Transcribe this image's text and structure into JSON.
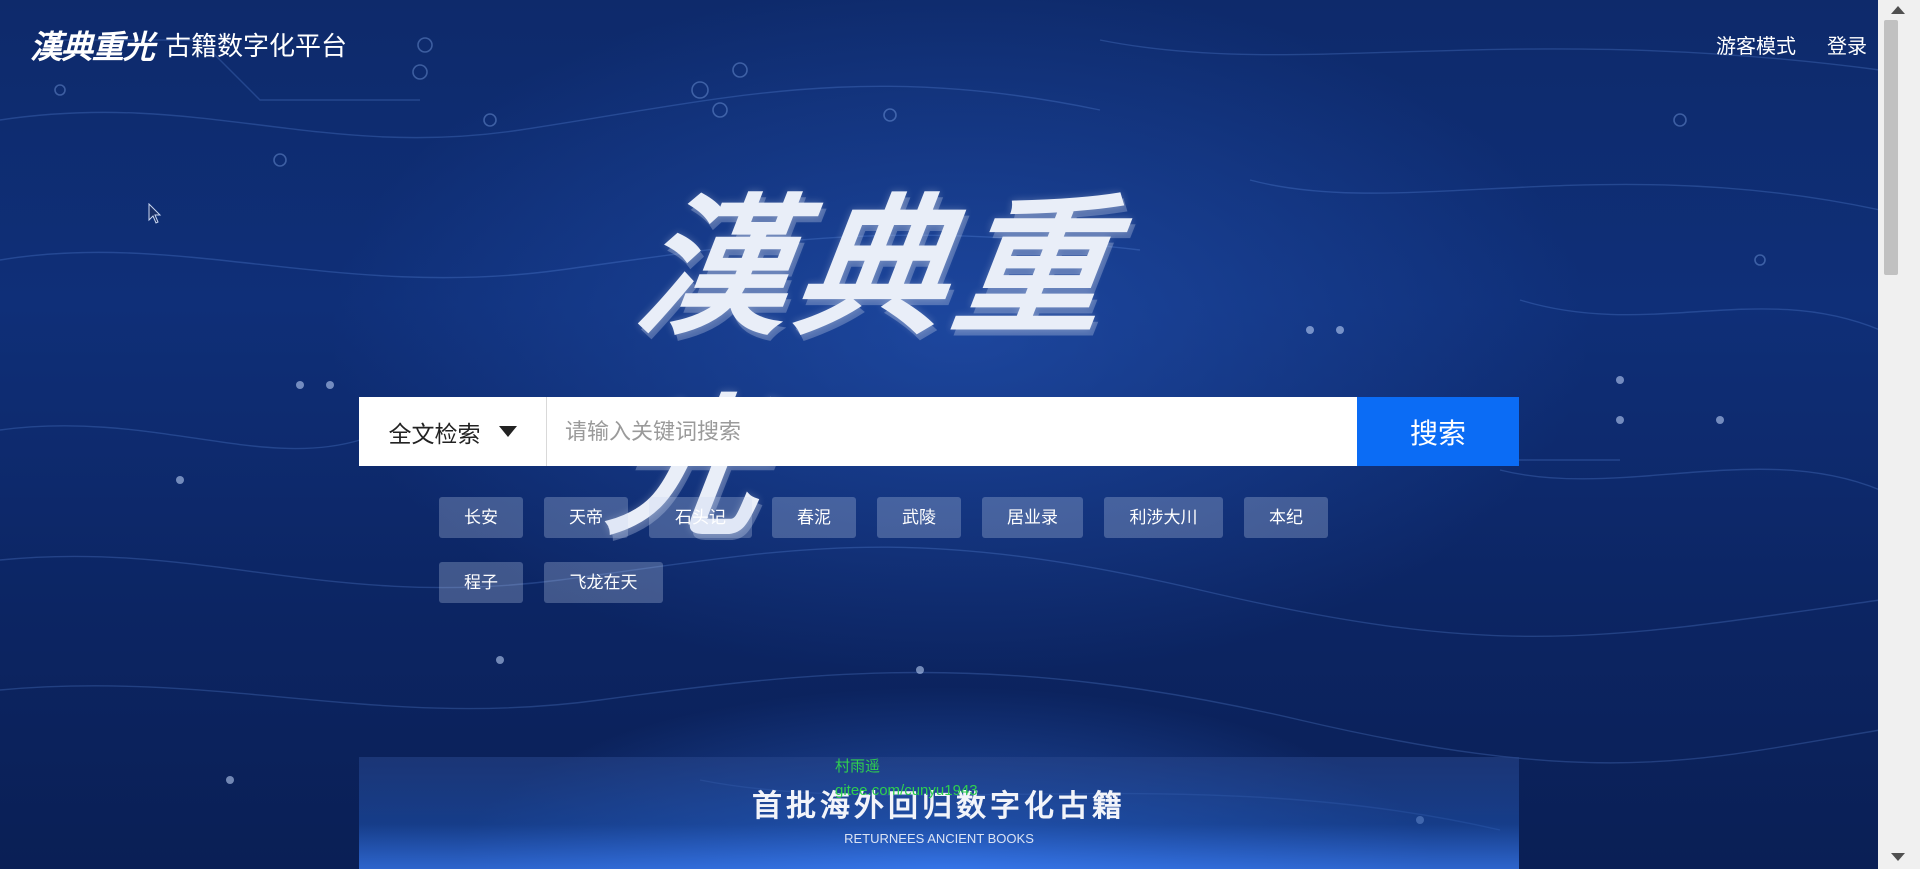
{
  "header": {
    "logo_text": "漢典重光",
    "platform_name": "古籍数字化平台",
    "nav": {
      "guest_mode": "游客模式",
      "login": "登录"
    }
  },
  "hero": {
    "calligraphy_title": "漢典重光"
  },
  "search": {
    "type_selected": "全文检索",
    "placeholder": "请输入关键词搜索",
    "button_label": "搜索"
  },
  "hot_tags": [
    "长安",
    "天帝",
    "石头记",
    "春泥",
    "武陵",
    "居业录",
    "利涉大川",
    "本纪",
    "程子",
    "飞龙在天"
  ],
  "banner": {
    "title": "首批海外回归数字化古籍",
    "subtitle": "RETURNEES ANCIENT BOOKS"
  },
  "watermark": {
    "line1": "村雨遥",
    "line2": "gitee.com/cunyu1943"
  },
  "colors": {
    "background": "#0f2f78",
    "search_button": "#0b6cf5",
    "tag_background": "rgba(200,215,240,0.28)",
    "watermark": "#2fd04f"
  }
}
